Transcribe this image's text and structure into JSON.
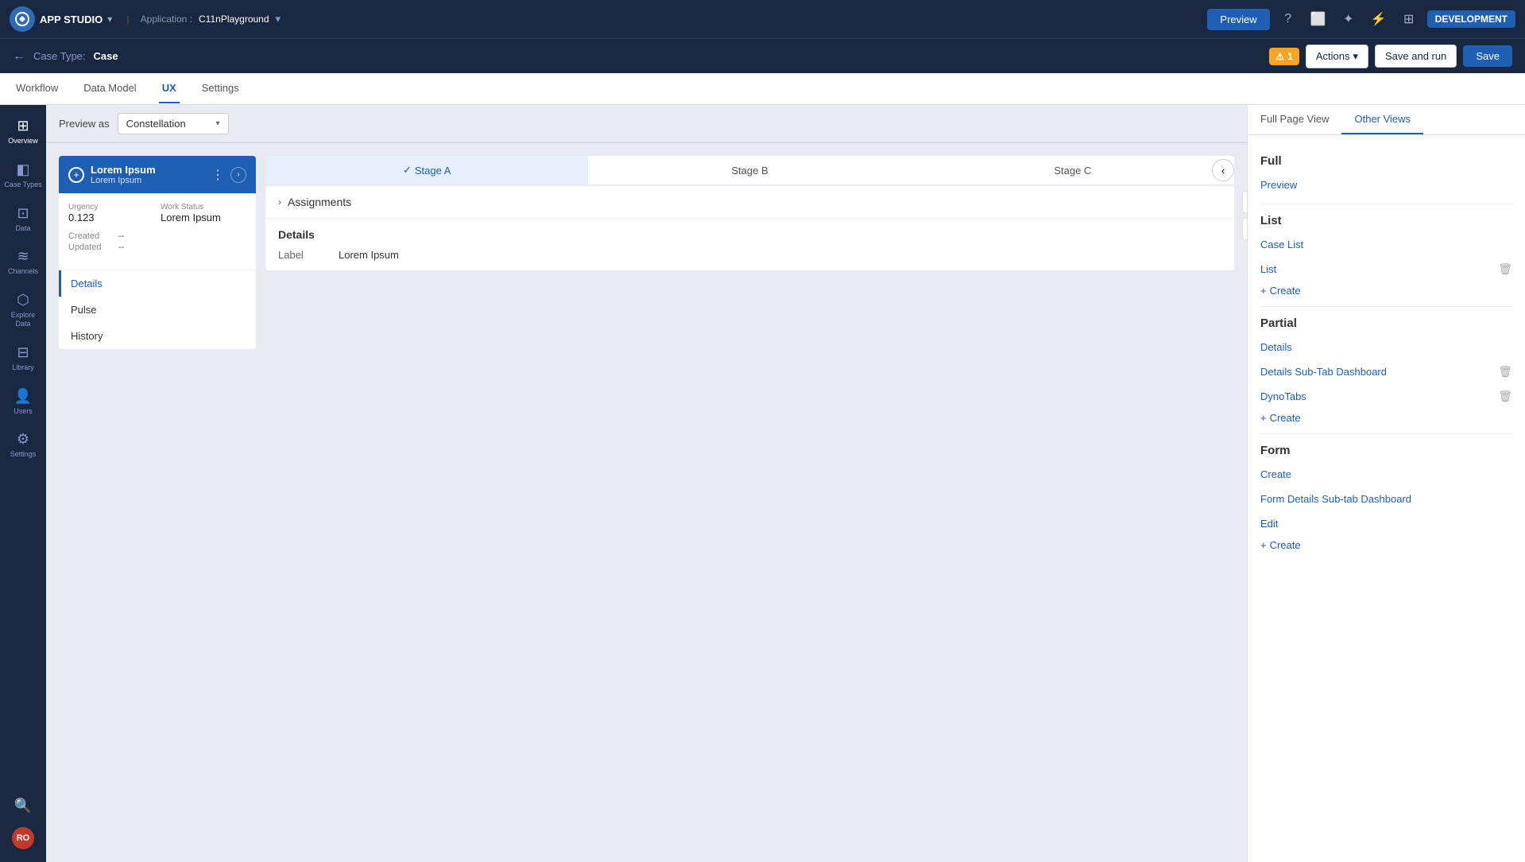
{
  "app": {
    "name": "APP STUDIO",
    "application_prefix": "Application :",
    "application_name": "C11nPlayground"
  },
  "topbar": {
    "preview_label": "Preview",
    "dev_badge": "DEVELOPMENT",
    "warning_count": "1",
    "actions_label": "Actions",
    "save_run_label": "Save and run",
    "save_label": "Save"
  },
  "second_bar": {
    "case_type_prefix": "Case Type:",
    "case_type_name": "Case"
  },
  "tabs": {
    "items": [
      {
        "label": "Workflow",
        "active": false
      },
      {
        "label": "Data Model",
        "active": false
      },
      {
        "label": "UX",
        "active": true
      },
      {
        "label": "Settings",
        "active": false
      }
    ]
  },
  "sidebar": {
    "items": [
      {
        "icon": "⊞",
        "label": "Overview"
      },
      {
        "icon": "◧",
        "label": "Case Types"
      },
      {
        "icon": "⊡",
        "label": "Data"
      },
      {
        "icon": "≋",
        "label": "Channels"
      },
      {
        "icon": "⬡",
        "label": "Explore Data"
      },
      {
        "icon": "⊟",
        "label": "Library"
      },
      {
        "icon": "👥",
        "label": "Users"
      },
      {
        "icon": "⚙",
        "label": "Settings"
      }
    ],
    "avatar": "RO",
    "search_icon": "🔍"
  },
  "preview_bar": {
    "label": "Preview as",
    "selected": "Constellation"
  },
  "case_card": {
    "icon": "+",
    "title": "Lorem Ipsum",
    "subtitle": "Lorem Ipsum",
    "urgency_label": "Urgency",
    "urgency_value": "0.123",
    "status_label": "Work Status",
    "status_value": "Lorem Ipsum",
    "created_label": "Created",
    "created_value": "--",
    "updated_label": "Updated",
    "updated_value": "--",
    "nav_items": [
      {
        "label": "Details",
        "active": true
      },
      {
        "label": "Pulse",
        "active": false
      },
      {
        "label": "History",
        "active": false
      }
    ]
  },
  "stages": {
    "items": [
      {
        "label": "Stage A",
        "completed": true,
        "active": true
      },
      {
        "label": "Stage B",
        "completed": false,
        "active": false
      },
      {
        "label": "Stage C",
        "completed": false,
        "active": false
      }
    ]
  },
  "assignments": {
    "label": "Assignments"
  },
  "details": {
    "section_label": "Details",
    "label_key": "Label",
    "label_value": "Lorem Ipsum"
  },
  "right_panel": {
    "tabs": [
      {
        "label": "Full Page View",
        "active": false
      },
      {
        "label": "Other Views",
        "active": true
      }
    ],
    "full_section": {
      "title": "Full",
      "preview_link": "Preview"
    },
    "list_section": {
      "title": "List",
      "case_list_link": "Case List",
      "list_link": "List",
      "create_label": "+ Create"
    },
    "partial_section": {
      "title": "Partial",
      "details_link": "Details",
      "details_sub_link": "Details Sub-Tab Dashboard",
      "dynotabs_link": "DynoTabs",
      "create_label": "+ Create"
    },
    "form_section": {
      "title": "Form",
      "create_link": "Create",
      "form_details_link": "Form Details Sub-tab Dashboard",
      "edit_link": "Edit",
      "create_label": "+ Create"
    }
  }
}
